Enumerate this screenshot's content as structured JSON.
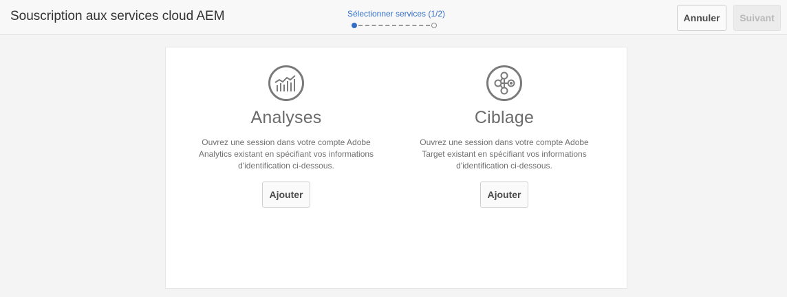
{
  "header": {
    "title": "Souscription aux services cloud AEM",
    "wizard_step_label": "Sélectionner services (1/2)",
    "cancel_label": "Annuler",
    "next_label": "Suivant"
  },
  "wizard": {
    "current_step": 1,
    "total_steps": 2
  },
  "services": [
    {
      "icon": "analytics-chart-icon",
      "title": "Analyses",
      "description": "Ouvrez une session dans votre compte Adobe Analytics existant en spécifiant vos informations d'identification ci-dessous.",
      "button_label": "Ajouter"
    },
    {
      "icon": "target-nodes-icon",
      "title": "Ciblage",
      "description": "Ouvrez une session dans votre compte Adobe Target existant en spécifiant vos informations d'identification ci-dessous.",
      "button_label": "Ajouter"
    }
  ],
  "colors": {
    "accent": "#326ec8",
    "background": "#f4f4f4",
    "card": "#ffffff",
    "disabled_text": "#b9b9b9"
  }
}
